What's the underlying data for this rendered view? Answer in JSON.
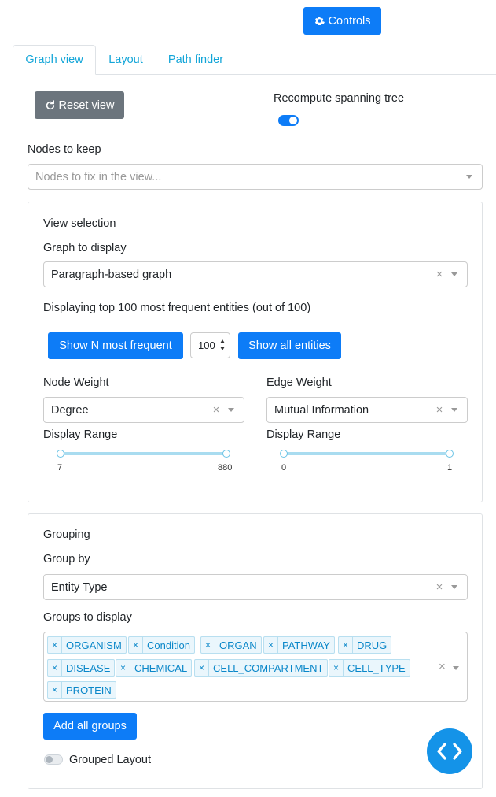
{
  "header": {
    "controls_label": "Controls"
  },
  "tabs": [
    {
      "label": "Graph view",
      "active": true
    },
    {
      "label": "Layout",
      "active": false
    },
    {
      "label": "Path finder",
      "active": false
    }
  ],
  "top": {
    "reset_label": "Reset view",
    "recompute_label": "Recompute spanning tree",
    "recompute_on": true,
    "nodes_to_keep_label": "Nodes to keep",
    "nodes_placeholder": "Nodes to fix in the view..."
  },
  "view_selection": {
    "title": "View selection",
    "graph_label": "Graph to display",
    "graph_value": "Paragraph-based graph",
    "info_text": "Displaying top 100 most frequent entities (out of 100)",
    "show_n_label": "Show N most frequent",
    "n_value": "100",
    "show_all_label": "Show all entities",
    "node_weight_label": "Node Weight",
    "node_weight_value": "Degree",
    "edge_weight_label": "Edge Weight",
    "edge_weight_value": "Mutual Information",
    "node_range_label": "Display Range",
    "edge_range_label": "Display Range",
    "node_range": {
      "min": "7",
      "max": "880"
    },
    "edge_range": {
      "min": "0",
      "max": "1"
    }
  },
  "grouping": {
    "title": "Grouping",
    "group_by_label": "Group by",
    "group_by_value": "Entity Type",
    "groups_label": "Groups to display",
    "groups": [
      "ORGANISM",
      "Condition",
      "ORGAN",
      "PATHWAY",
      "DRUG",
      "DISEASE",
      "CHEMICAL",
      "CELL_COMPARTMENT",
      "CELL_TYPE",
      "PROTEIN"
    ],
    "add_all_label": "Add all groups",
    "grouped_layout_label": "Grouped Layout",
    "grouped_layout_on": false
  },
  "colors": {
    "primary": "#0d7cf7",
    "secondary": "#6c757d",
    "tab_link": "#12a5d8",
    "fab": "#1493e8"
  },
  "icons": {
    "controls": "gear-icon",
    "reset": "refresh-icon",
    "fab": "code-icon"
  }
}
